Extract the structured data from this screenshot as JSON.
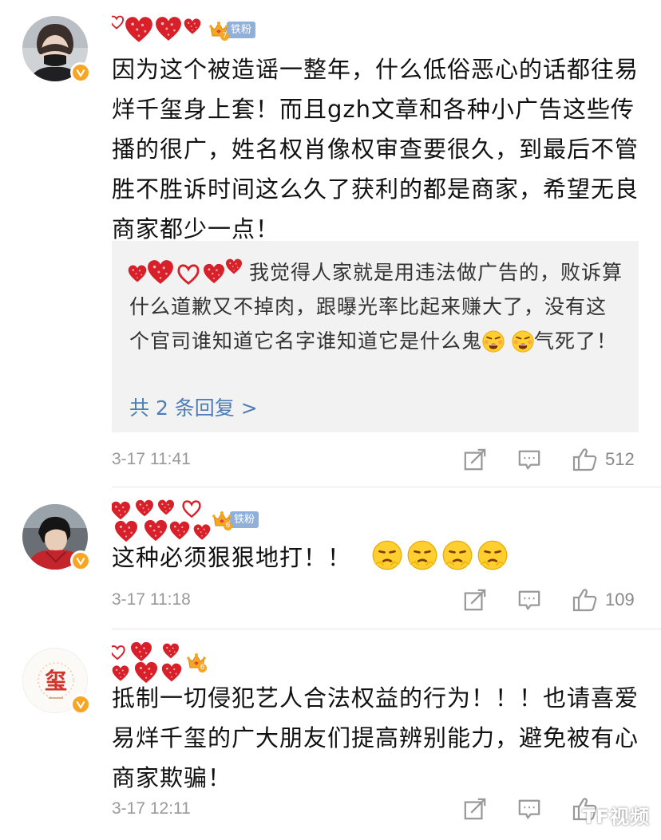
{
  "comments": [
    {
      "fan_label": "铁粉",
      "fan_level": "7",
      "text": "因为这个被造谣一整年，什么低俗恶心的话都往易烊千玺身上套！而且gzh文章和各种小广告这些传播的很广，姓名权肖像权审查要很久，到最后不管胜不胜诉时间这么久了获利的都是商家，希望无良商家都少一点！",
      "reply": {
        "text": "我觉得人家就是用违法做广告的，败诉算什么道歉又不掉肉，跟曝光率比起来赚大了，没有这个官司谁知道它名字谁知道它是什么鬼",
        "suffix": "气死了！",
        "more": "共 2 条回复 >"
      },
      "time": "3-17 11:41",
      "likes": "512"
    },
    {
      "fan_label": "铁粉",
      "fan_level": "6",
      "text": "这种必须狠狠地打！！",
      "time": "3-17 11:18",
      "likes": "109"
    },
    {
      "fan_level": "6",
      "text": "抵制一切侵犯艺人合法权益的行为！！！也请喜爱易烊千玺的广大朋友们提高辨别能力，避免被有心商家欺骗！",
      "time": "3-17 12:11",
      "avatar_text": "玺"
    }
  ],
  "watermark": "TF视频",
  "colors": {
    "verified": "#f6a623",
    "fan_badge": "#8fb0d8",
    "link": "#4f7db4",
    "heart": "#d8202a"
  },
  "icons": [
    "repost-icon",
    "comment-icon",
    "like-icon",
    "verified-badge-icon",
    "crown-icon",
    "heart-icon",
    "angry-emoji-icon",
    "frowning-emoji-icon"
  ]
}
